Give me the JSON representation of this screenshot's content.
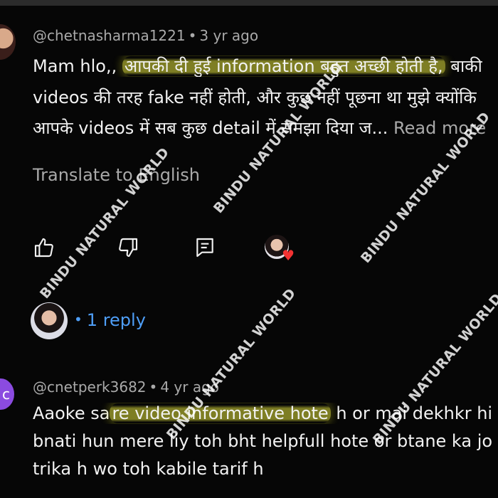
{
  "comment1": {
    "handle": "@chetnasharma1221",
    "separator": "•",
    "age": "3 yr ago",
    "line1_pre": "Mam hlo,, ",
    "line1_highlight": "आपकी दी हुई information बहुत अच्छी होती है,",
    "line1_post": " बाकी",
    "line2": "videos की तरह fake नहीं होती, और कुछ नहीं पूछना था मुझे क्योंकि",
    "line3": "आपके videos में सब कुछ detail में समझा दिया ज...",
    "read_more": "Read more",
    "translate": "Translate to English",
    "actions": {
      "like_icon": "thumbs-up-icon",
      "dislike_icon": "thumbs-down-icon",
      "reply_icon": "reply-icon",
      "creator_heart_icon": "heart-icon"
    },
    "replies": {
      "dot": "•",
      "label": "1 reply"
    }
  },
  "comment2": {
    "avatar_letter": "c",
    "handle": "@cnetperk3682",
    "separator": "•",
    "age": "4 yr ago",
    "line1_pre": "Aaoke sa",
    "line1_highlight": "re video informative hote",
    "line1_post": " h or mai dekhkr hi",
    "line2": "bnati hun mere liy toh bht helpfull hote or btane ka jo",
    "line3": "trika h wo toh kabile tarif h"
  },
  "watermark": "BINDU NATURAL WORLD",
  "colors": {
    "background": "#060606",
    "text": "#f2f2f2",
    "secondary": "#a9a9a9",
    "link": "#4e9ef7",
    "highlight": "#e1e13c",
    "heart": "#f23232",
    "avatar_purple": "#8b4be0"
  }
}
